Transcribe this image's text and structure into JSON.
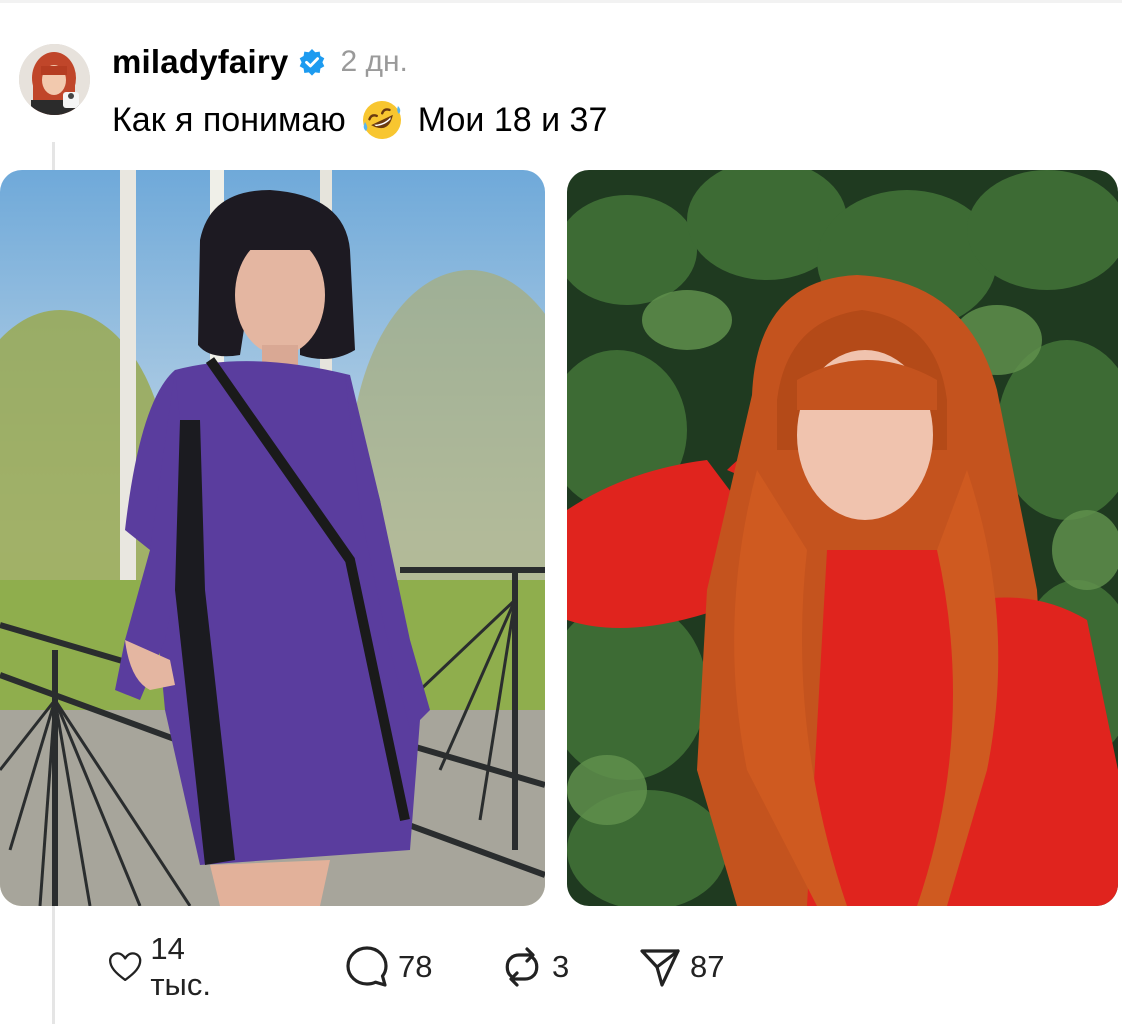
{
  "post": {
    "username": "miladyfairy",
    "time_ago": "2 дн.",
    "caption_before": "Как я понимаю",
    "caption_emoji": "rofl-emoji",
    "caption_after": "Мои 18 и 37"
  },
  "media": [
    {
      "name": "photo-left",
      "subject": "woman-purple-dress"
    },
    {
      "name": "photo-right",
      "subject": "woman-red-hair"
    }
  ],
  "actions": {
    "likes": "14 тыс.",
    "comments": "78",
    "reposts": "3",
    "shares": "87"
  },
  "icons": [
    "verified-badge-icon",
    "heart-icon",
    "comment-icon",
    "repost-icon",
    "share-icon"
  ],
  "colors": {
    "verified": "#1d9bf0",
    "muted": "#9a9a9a",
    "thread_line": "#e5e5e5"
  }
}
